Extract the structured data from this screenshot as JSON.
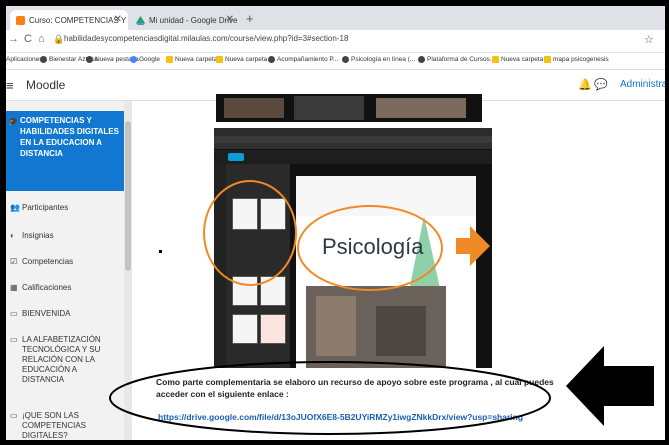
{
  "browser": {
    "tabs": [
      {
        "label": "Curso: COMPETENCIAS Y HABIL...",
        "active": true
      },
      {
        "label": "Mi unidad - Google Drive",
        "active": false
      }
    ],
    "new_tab": "+",
    "url": "habilidadesycompetenciasdigital.milaulas.com/course/view.php?id=3#section-18",
    "bookmarks": [
      "Aplicaciones",
      "Bienestar Azteca",
      "Nueva pestaña",
      "Google",
      "Nueva carpeta",
      "Nueva carpeta",
      "Acompañamiento P...",
      "Psicología en línea (...",
      "Plataforma de Cursos...",
      "Nueva carpeta",
      "mapa psicogenesis"
    ]
  },
  "moodle": {
    "site_name": "Moodle",
    "user_label": "Administrador U",
    "course_title": "COMPETENCIAS Y HABILIDADES DIGITALES EN LA EDUCACION A DISTANCIA",
    "nav": [
      {
        "label": "Participantes",
        "icon": "participants-icon"
      },
      {
        "label": "Insignias",
        "icon": "badge-icon"
      },
      {
        "label": "Competencias",
        "icon": "checkbox-icon"
      },
      {
        "label": "Calificaciones",
        "icon": "grades-icon"
      },
      {
        "label": "BIENVENIDA",
        "icon": "folder-icon"
      },
      {
        "label": "LA ALFABETIZACIÓN TECNOLÓGICA Y SU RELACIÓN CON LA EDUCACIÓN A DISTANCIA",
        "icon": "folder-icon"
      },
      {
        "label": "¡QUE SON LAS COMPETENCIAS DIGITALES?",
        "icon": "folder-icon"
      }
    ]
  },
  "content": {
    "embedded_title": "Psicología",
    "description": "Como parte complementaria se  elaboro un recurso de  apoyo  sobre este  programa , al cual puedes  acceder con el siguiente enlace :",
    "link": "https://drive.google.com/file/d/13oJUOfX6E8-5B2UYiRMZy1iwgZNkkDrx/view?usp=sharing"
  },
  "colors": {
    "brand_blue": "#1177d1",
    "annotation_orange": "#f08a24",
    "annotation_black": "#000000"
  }
}
